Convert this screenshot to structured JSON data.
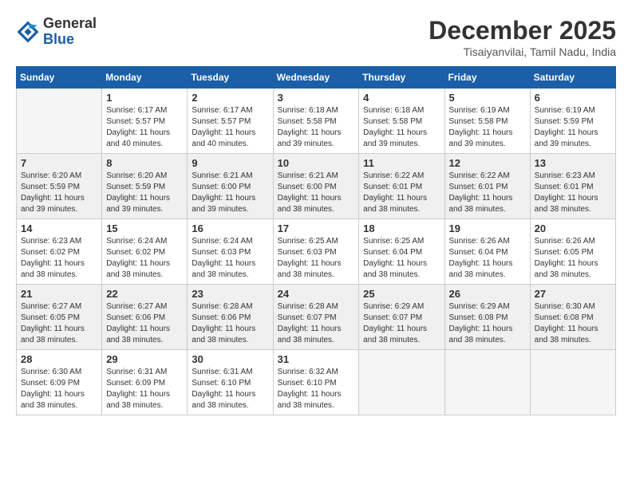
{
  "logo": {
    "line1": "General",
    "line2": "Blue"
  },
  "title": "December 2025",
  "location": "Tisaiyanvilai, Tamil Nadu, India",
  "headers": [
    "Sunday",
    "Monday",
    "Tuesday",
    "Wednesday",
    "Thursday",
    "Friday",
    "Saturday"
  ],
  "weeks": [
    [
      {
        "day": "",
        "info": ""
      },
      {
        "day": "1",
        "info": "Sunrise: 6:17 AM\nSunset: 5:57 PM\nDaylight: 11 hours\nand 40 minutes."
      },
      {
        "day": "2",
        "info": "Sunrise: 6:17 AM\nSunset: 5:57 PM\nDaylight: 11 hours\nand 40 minutes."
      },
      {
        "day": "3",
        "info": "Sunrise: 6:18 AM\nSunset: 5:58 PM\nDaylight: 11 hours\nand 39 minutes."
      },
      {
        "day": "4",
        "info": "Sunrise: 6:18 AM\nSunset: 5:58 PM\nDaylight: 11 hours\nand 39 minutes."
      },
      {
        "day": "5",
        "info": "Sunrise: 6:19 AM\nSunset: 5:58 PM\nDaylight: 11 hours\nand 39 minutes."
      },
      {
        "day": "6",
        "info": "Sunrise: 6:19 AM\nSunset: 5:59 PM\nDaylight: 11 hours\nand 39 minutes."
      }
    ],
    [
      {
        "day": "7",
        "info": "Sunrise: 6:20 AM\nSunset: 5:59 PM\nDaylight: 11 hours\nand 39 minutes."
      },
      {
        "day": "8",
        "info": "Sunrise: 6:20 AM\nSunset: 5:59 PM\nDaylight: 11 hours\nand 39 minutes."
      },
      {
        "day": "9",
        "info": "Sunrise: 6:21 AM\nSunset: 6:00 PM\nDaylight: 11 hours\nand 39 minutes."
      },
      {
        "day": "10",
        "info": "Sunrise: 6:21 AM\nSunset: 6:00 PM\nDaylight: 11 hours\nand 38 minutes."
      },
      {
        "day": "11",
        "info": "Sunrise: 6:22 AM\nSunset: 6:01 PM\nDaylight: 11 hours\nand 38 minutes."
      },
      {
        "day": "12",
        "info": "Sunrise: 6:22 AM\nSunset: 6:01 PM\nDaylight: 11 hours\nand 38 minutes."
      },
      {
        "day": "13",
        "info": "Sunrise: 6:23 AM\nSunset: 6:01 PM\nDaylight: 11 hours\nand 38 minutes."
      }
    ],
    [
      {
        "day": "14",
        "info": "Sunrise: 6:23 AM\nSunset: 6:02 PM\nDaylight: 11 hours\nand 38 minutes."
      },
      {
        "day": "15",
        "info": "Sunrise: 6:24 AM\nSunset: 6:02 PM\nDaylight: 11 hours\nand 38 minutes."
      },
      {
        "day": "16",
        "info": "Sunrise: 6:24 AM\nSunset: 6:03 PM\nDaylight: 11 hours\nand 38 minutes."
      },
      {
        "day": "17",
        "info": "Sunrise: 6:25 AM\nSunset: 6:03 PM\nDaylight: 11 hours\nand 38 minutes."
      },
      {
        "day": "18",
        "info": "Sunrise: 6:25 AM\nSunset: 6:04 PM\nDaylight: 11 hours\nand 38 minutes."
      },
      {
        "day": "19",
        "info": "Sunrise: 6:26 AM\nSunset: 6:04 PM\nDaylight: 11 hours\nand 38 minutes."
      },
      {
        "day": "20",
        "info": "Sunrise: 6:26 AM\nSunset: 6:05 PM\nDaylight: 11 hours\nand 38 minutes."
      }
    ],
    [
      {
        "day": "21",
        "info": "Sunrise: 6:27 AM\nSunset: 6:05 PM\nDaylight: 11 hours\nand 38 minutes."
      },
      {
        "day": "22",
        "info": "Sunrise: 6:27 AM\nSunset: 6:06 PM\nDaylight: 11 hours\nand 38 minutes."
      },
      {
        "day": "23",
        "info": "Sunrise: 6:28 AM\nSunset: 6:06 PM\nDaylight: 11 hours\nand 38 minutes."
      },
      {
        "day": "24",
        "info": "Sunrise: 6:28 AM\nSunset: 6:07 PM\nDaylight: 11 hours\nand 38 minutes."
      },
      {
        "day": "25",
        "info": "Sunrise: 6:29 AM\nSunset: 6:07 PM\nDaylight: 11 hours\nand 38 minutes."
      },
      {
        "day": "26",
        "info": "Sunrise: 6:29 AM\nSunset: 6:08 PM\nDaylight: 11 hours\nand 38 minutes."
      },
      {
        "day": "27",
        "info": "Sunrise: 6:30 AM\nSunset: 6:08 PM\nDaylight: 11 hours\nand 38 minutes."
      }
    ],
    [
      {
        "day": "28",
        "info": "Sunrise: 6:30 AM\nSunset: 6:09 PM\nDaylight: 11 hours\nand 38 minutes."
      },
      {
        "day": "29",
        "info": "Sunrise: 6:31 AM\nSunset: 6:09 PM\nDaylight: 11 hours\nand 38 minutes."
      },
      {
        "day": "30",
        "info": "Sunrise: 6:31 AM\nSunset: 6:10 PM\nDaylight: 11 hours\nand 38 minutes."
      },
      {
        "day": "31",
        "info": "Sunrise: 6:32 AM\nSunset: 6:10 PM\nDaylight: 11 hours\nand 38 minutes."
      },
      {
        "day": "",
        "info": ""
      },
      {
        "day": "",
        "info": ""
      },
      {
        "day": "",
        "info": ""
      }
    ]
  ]
}
